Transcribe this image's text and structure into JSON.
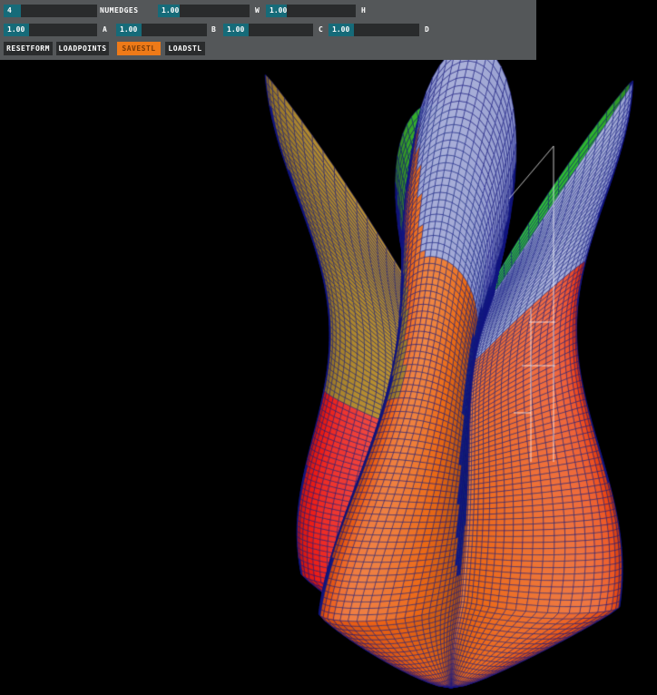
{
  "panel": {
    "row1": [
      {
        "label": "NUMEDGES",
        "value": "4"
      },
      {
        "label": "W",
        "value": "1.00"
      },
      {
        "label": "H",
        "value": "1.00"
      }
    ],
    "row2": [
      {
        "label": "A",
        "value": "1.00"
      },
      {
        "label": "B",
        "value": "1.00"
      },
      {
        "label": "C",
        "value": "1.00"
      },
      {
        "label": "D",
        "value": "1.00"
      }
    ],
    "buttons": [
      {
        "label": "RESETFORM",
        "active": false
      },
      {
        "label": "LOADPOINTS",
        "active": false
      },
      {
        "label": "SAVESTL",
        "active": true
      },
      {
        "label": "LOADSTL",
        "active": false
      }
    ],
    "colors": {
      "panel_bg": "#545759",
      "slider_track": "#292b2c",
      "value_fill": "#166b79",
      "button_bg": "#2a2c2d",
      "button_active": "#ee7a18",
      "text": "#ffffff"
    }
  },
  "viewport": {
    "object": "twisted-ruled-surface-sculpture",
    "background": "#000000",
    "palette": {
      "front_red": "#cc1620",
      "front_orange": "#e07828",
      "olive": "#a08828",
      "back_green": "#4aa030",
      "bottom_green": "#9cc040",
      "lavender": "#b0b4dc",
      "hatch_navy": "#141687",
      "wireframe": "#ffffff"
    }
  }
}
